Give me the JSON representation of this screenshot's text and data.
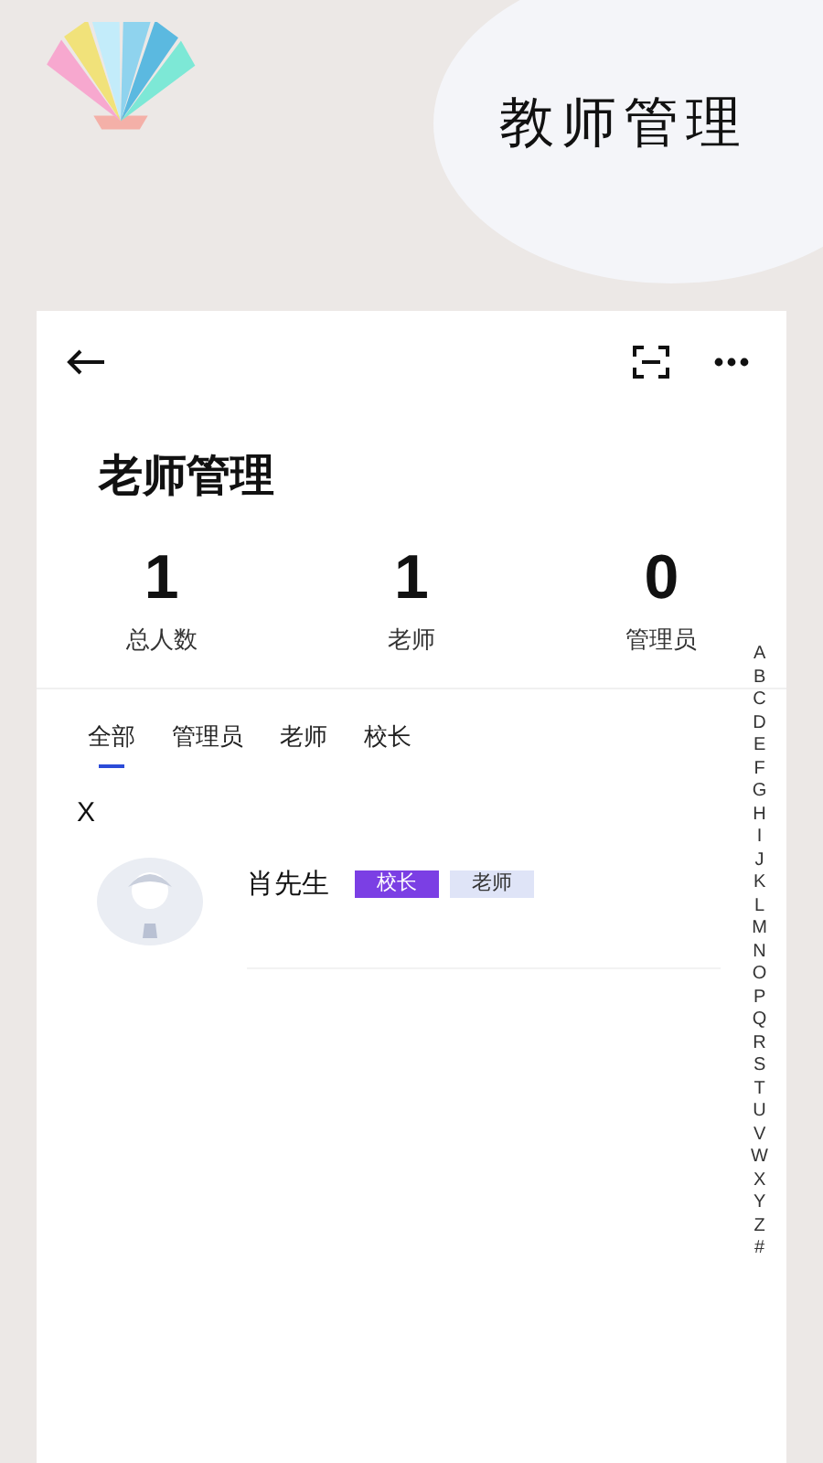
{
  "banner": {
    "title": "教师管理"
  },
  "page": {
    "title": "老师管理"
  },
  "stats": [
    {
      "value": "1",
      "label": "总人数"
    },
    {
      "value": "1",
      "label": "老师"
    },
    {
      "value": "0",
      "label": "管理员"
    }
  ],
  "tabs": [
    {
      "label": "全部",
      "selected": true
    },
    {
      "label": "管理员",
      "selected": false
    },
    {
      "label": "老师",
      "selected": false
    },
    {
      "label": "校长",
      "selected": false
    }
  ],
  "groups": [
    {
      "letter": "X",
      "people": [
        {
          "name": "肖先生",
          "tags": [
            {
              "label": "校长",
              "color": "#7b3fe4"
            },
            {
              "label": "老师",
              "color": "#dfe4f7"
            }
          ]
        }
      ]
    }
  ],
  "index": [
    "A",
    "B",
    "C",
    "D",
    "E",
    "F",
    "G",
    "H",
    "I",
    "J",
    "K",
    "L",
    "M",
    "N",
    "O",
    "P",
    "Q",
    "R",
    "S",
    "T",
    "U",
    "V",
    "W",
    "X",
    "Y",
    "Z",
    "#"
  ]
}
